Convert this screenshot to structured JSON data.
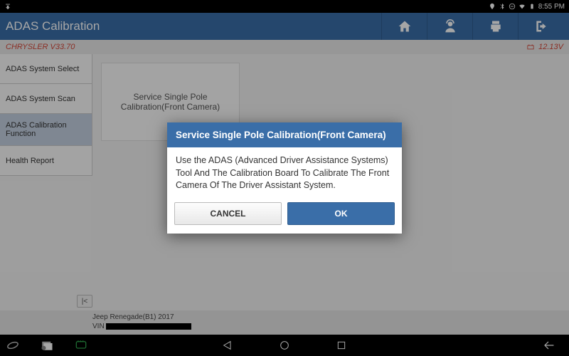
{
  "statusbar": {
    "time": "8:55 PM"
  },
  "header": {
    "title": "ADAS Calibration"
  },
  "vehicle_strip": {
    "name": "CHRYSLER V33.70",
    "voltage": "12.13V"
  },
  "sidebar": {
    "items": [
      {
        "label": "ADAS System Select"
      },
      {
        "label": "ADAS System Scan"
      },
      {
        "label": "ADAS Calibration Function"
      },
      {
        "label": "Health Report"
      }
    ]
  },
  "content": {
    "card_label": "Service Single Pole Calibration(Front Camera)"
  },
  "collapse_glyph": "|<",
  "vehicle_detail": {
    "model": "Jeep Renegade(B1) 2017",
    "vin_label": "VIN"
  },
  "dialog": {
    "title": "Service Single Pole Calibration(Front Camera)",
    "body": "Use the ADAS (Advanced Driver Assistance Systems) Tool And The Calibration Board To Calibrate The Front Camera Of The Driver Assistant System.",
    "cancel": "CANCEL",
    "ok": "OK"
  }
}
